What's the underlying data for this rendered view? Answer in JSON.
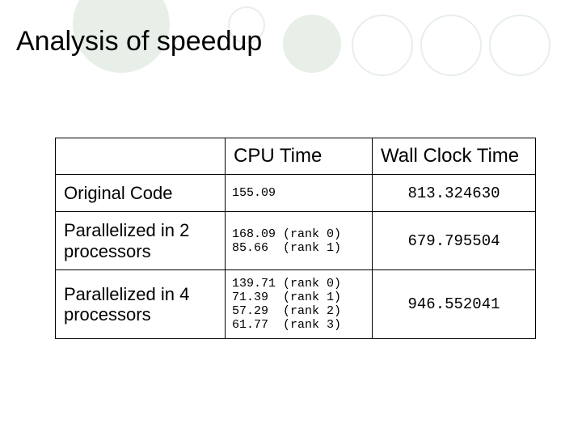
{
  "title": "Analysis of speedup",
  "columns": {
    "blank": "",
    "cpu": "CPU Time",
    "wall": "Wall Clock Time"
  },
  "rows": [
    {
      "label": "Original Code",
      "cpu": "155.09",
      "wall": "813.324630"
    },
    {
      "label": "Parallelized in 2 processors",
      "cpu": "168.09 (rank 0)\n85.66  (rank 1)",
      "wall": "679.795504"
    },
    {
      "label": "Parallelized in 4 processors",
      "cpu": "139.71 (rank 0)\n71.39  (rank 1)\n57.29  (rank 2)\n61.77  (rank 3)",
      "wall": "946.552041"
    }
  ]
}
